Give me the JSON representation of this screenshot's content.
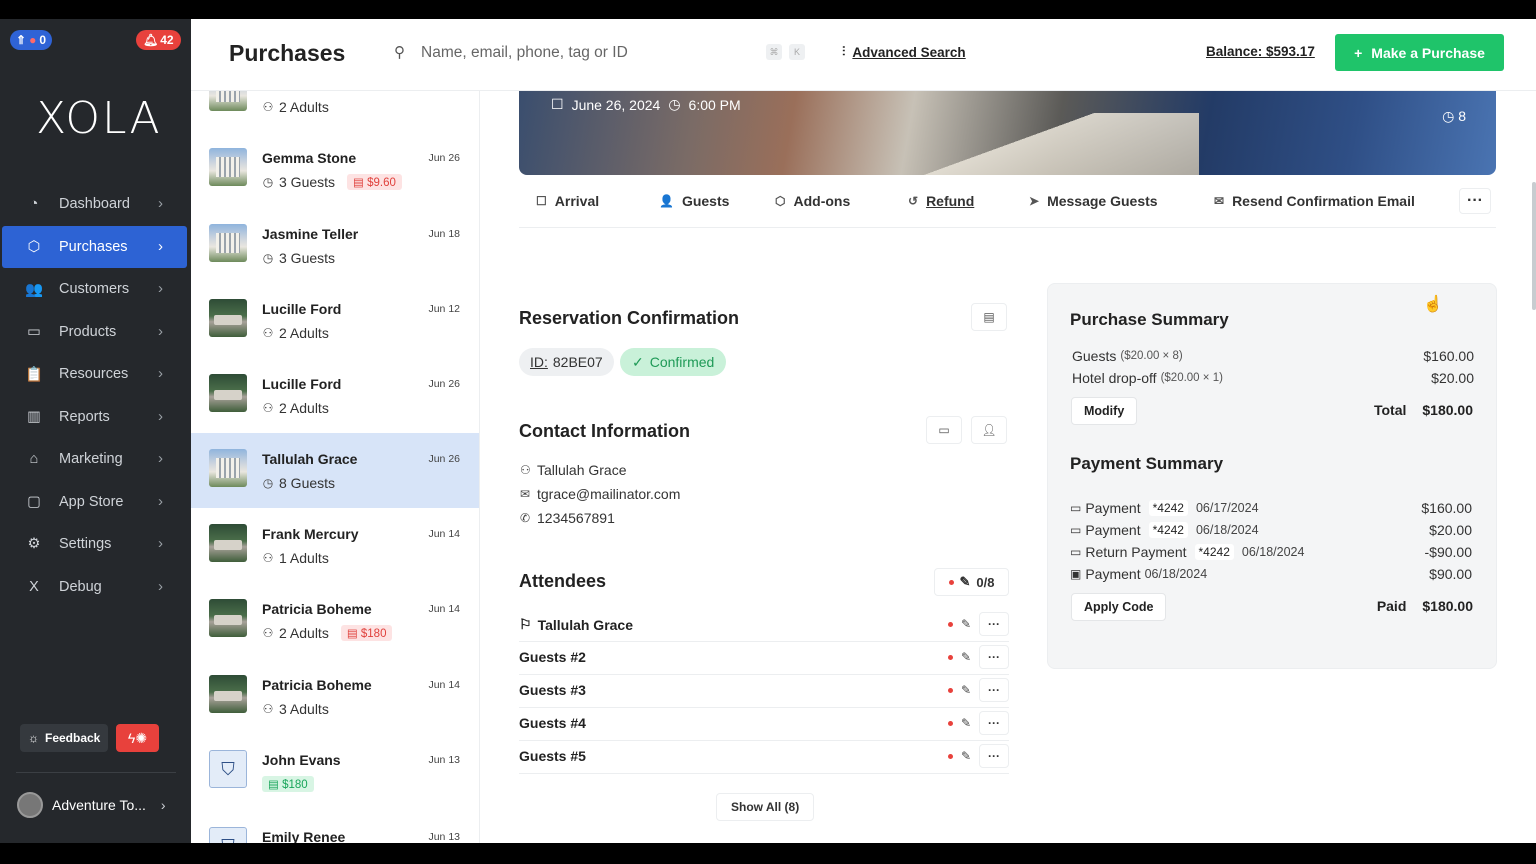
{
  "sidebar": {
    "notif_left": "0",
    "notif_right": "42",
    "logo": "XOLA",
    "items": [
      {
        "label": "Dashboard",
        "icon": "dashboard-icon",
        "glyph": "◔"
      },
      {
        "label": "Purchases",
        "icon": "purchases-icon",
        "glyph": "⬡"
      },
      {
        "label": "Customers",
        "icon": "customers-icon",
        "glyph": "👥"
      },
      {
        "label": "Products",
        "icon": "products-icon",
        "glyph": "▭"
      },
      {
        "label": "Resources",
        "icon": "resources-icon",
        "glyph": "📋"
      },
      {
        "label": "Reports",
        "icon": "reports-icon",
        "glyph": "▥"
      },
      {
        "label": "Marketing",
        "icon": "marketing-icon",
        "glyph": "⌂"
      },
      {
        "label": "App Store",
        "icon": "app-store-icon",
        "glyph": "▢"
      },
      {
        "label": "Settings",
        "icon": "settings-icon",
        "glyph": "⚙"
      },
      {
        "label": "Debug",
        "icon": "debug-icon",
        "glyph": "X"
      }
    ],
    "active_index": 1,
    "feedback_label": "Feedback",
    "account_label": "Adventure To..."
  },
  "header": {
    "title": "Purchases",
    "search_placeholder": "Name, email, phone, tag or ID",
    "kbd1": "⌘",
    "kbd2": "K",
    "advanced_search": "Advanced Search",
    "balance": "Balance: $593.17",
    "make_purchase": "Make a Purchase"
  },
  "purchases": [
    {
      "name": "",
      "date": "",
      "sub": "2 Adults",
      "sub_icon": "person",
      "thumb": "building",
      "pill": null
    },
    {
      "name": "Gemma Stone",
      "date": "Jun 26",
      "sub": "3 Guests",
      "sub_icon": "clock",
      "thumb": "building",
      "pill": {
        "type": "red",
        "text": "$9.60"
      }
    },
    {
      "name": "Jasmine Teller",
      "date": "Jun 18",
      "sub": "3 Guests",
      "sub_icon": "clock",
      "thumb": "building",
      "pill": null
    },
    {
      "name": "Lucille Ford",
      "date": "Jun 12",
      "sub": "2 Adults",
      "sub_icon": "person",
      "thumb": "forest",
      "pill": null
    },
    {
      "name": "Lucille Ford",
      "date": "Jun 26",
      "sub": "2 Adults",
      "sub_icon": "person",
      "thumb": "forest",
      "pill": null
    },
    {
      "name": "Tallulah Grace",
      "date": "Jun 26",
      "sub": "8 Guests",
      "sub_icon": "clock",
      "thumb": "building",
      "pill": null,
      "active": true
    },
    {
      "name": "Frank Mercury",
      "date": "Jun 14",
      "sub": "1 Adults",
      "sub_icon": "person",
      "thumb": "forest",
      "pill": null
    },
    {
      "name": "Patricia Boheme",
      "date": "Jun 14",
      "sub": "2 Adults",
      "sub_icon": "person",
      "thumb": "forest",
      "pill": {
        "type": "red",
        "text": "$180"
      }
    },
    {
      "name": "Patricia Boheme",
      "date": "Jun 14",
      "sub": "3 Adults",
      "sub_icon": "person",
      "thumb": "forest",
      "pill": null
    },
    {
      "name": "John Evans",
      "date": "Jun 13",
      "sub": "",
      "sub_icon": "",
      "thumb": "bag",
      "pill": {
        "type": "green",
        "text": "$180"
      }
    },
    {
      "name": "Emily Renee",
      "date": "Jun 13",
      "sub": "",
      "sub_icon": "",
      "thumb": "bag",
      "pill": null
    }
  ],
  "detail": {
    "hero_date": "June 26, 2024",
    "hero_time": "6:00 PM",
    "hero_count": "8",
    "actions": [
      {
        "label": "Arrival",
        "icon": "arrival-icon",
        "glyph": "☐"
      },
      {
        "label": "Guests",
        "icon": "guests-icon",
        "glyph": "👤"
      },
      {
        "label": "Add-ons",
        "icon": "add-ons-icon",
        "glyph": "⬡"
      },
      {
        "label": "Refund",
        "icon": "refund-icon",
        "glyph": "↺"
      },
      {
        "label": "Message Guests",
        "icon": "send-icon",
        "glyph": "➤"
      },
      {
        "label": "Resend Confirmation Email",
        "icon": "mail-icon",
        "glyph": "✉"
      }
    ],
    "reservation_title": "Reservation Confirmation",
    "id_label": "ID:",
    "id_value": "82BE07",
    "status": "Confirmed",
    "contact_title": "Contact Information",
    "contact_name": "Tallulah Grace",
    "contact_email": "tgrace@mailinator.com",
    "contact_phone": "1234567891",
    "attendees_title": "Attendees",
    "attendees_count": "0/8",
    "attendees": [
      "Tallulah Grace",
      "Guests #2",
      "Guests #3",
      "Guests #4",
      "Guests #5"
    ],
    "show_all": "Show All (8)"
  },
  "summary": {
    "purchase_title": "Purchase Summary",
    "lines": [
      {
        "label": "Guests",
        "detail": "($20.00 × 8)",
        "amount": "$160.00"
      },
      {
        "label": "Hotel drop-off",
        "detail": "($20.00 × 1)",
        "amount": "$20.00"
      }
    ],
    "modify": "Modify",
    "total_label": "Total",
    "total": "$180.00",
    "payment_title": "Payment Summary",
    "payments": [
      {
        "label": "Payment",
        "mask": "*4242",
        "date": "06/17/2024",
        "amount": "$160.00",
        "icon": "card"
      },
      {
        "label": "Payment",
        "mask": "*4242",
        "date": "06/18/2024",
        "amount": "$20.00",
        "icon": "card"
      },
      {
        "label": "Return Payment",
        "mask": "*4242",
        "date": "06/18/2024",
        "amount": "-$90.00",
        "icon": "card"
      },
      {
        "label": "Payment",
        "mask": "",
        "date": "06/18/2024",
        "amount": "$90.00",
        "icon": "cash"
      }
    ],
    "apply_code": "Apply Code",
    "paid_label": "Paid",
    "paid": "$180.00"
  }
}
